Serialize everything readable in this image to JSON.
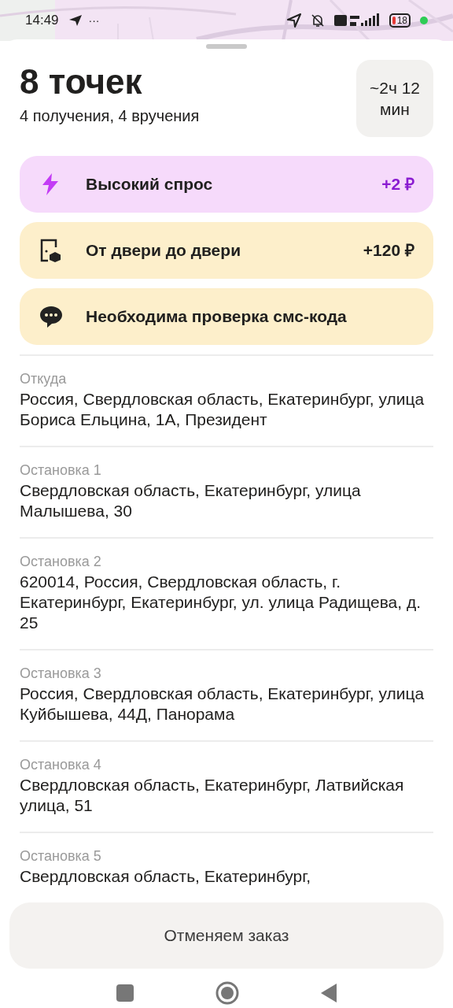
{
  "status_bar": {
    "time": "14:49",
    "more": "···",
    "battery": "18"
  },
  "header": {
    "title": "8 точек",
    "subtitle": "4 получения, 4 вручения",
    "duration": "~2ч 12 мин"
  },
  "badges": [
    {
      "kind": "demand",
      "label": "Высокий спрос",
      "amount": "+2 ₽"
    },
    {
      "kind": "door",
      "label": "От двери до двери",
      "amount": "+120 ₽"
    },
    {
      "kind": "sms",
      "label": "Необходима проверка смс-кода"
    }
  ],
  "stops": [
    {
      "label": "Откуда",
      "address": "Россия, Свердловская область, Екатеринбург, улица Бориса Ельцина, 1А, Президент"
    },
    {
      "label": "Остановка 1",
      "address": "Свердловская область, Екатеринбург, улица Малышева, 30"
    },
    {
      "label": "Остановка 2",
      "address": "620014, Россия, Свердловская область, г. Екатеринбург, Екатеринбург, ул. улица Радищева, д. 25"
    },
    {
      "label": "Остановка 3",
      "address": "Россия, Свердловская область, Екатеринбург, улица Куйбышева, 44Д, Панорама"
    },
    {
      "label": "Остановка 4",
      "address": "Свердловская область, Екатеринбург, Латвийская улица, 51"
    },
    {
      "label": "Остановка 5",
      "address": "Свердловская область, Екатеринбург,"
    }
  ],
  "cancel_button": "Отменяем заказ"
}
